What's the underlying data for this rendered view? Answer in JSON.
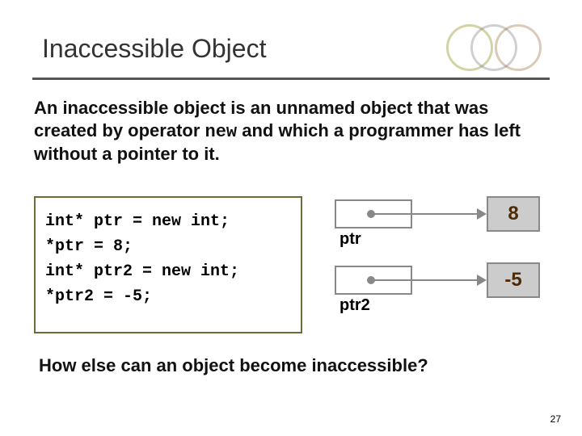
{
  "slide": {
    "title": "Inaccessible Object",
    "body_pre": "An inaccessible object is an unnamed object that was created by operator ",
    "body_new": "new",
    "body_post": " and which a programmer has left without a pointer to it.",
    "code": {
      "l1": "int* ptr = new int;",
      "l2": "*ptr = 8;",
      "l3": "int* ptr2 = new int;",
      "l4": "*ptr2 = -5;"
    },
    "diagram": {
      "ptr1": {
        "label": "ptr",
        "value": "8"
      },
      "ptr2": {
        "label": "ptr2",
        "value": "-5"
      }
    },
    "question": "How else can an object become inaccessible?",
    "page_number": "27"
  }
}
